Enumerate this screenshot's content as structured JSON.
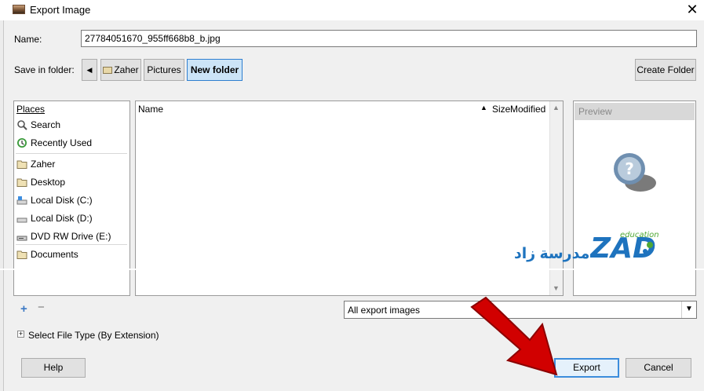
{
  "window": {
    "title": "Export Image"
  },
  "name_row": {
    "label": "Name:",
    "value": "27784051670_955ff668b8_b.jpg"
  },
  "folder_row": {
    "label": "Save in folder:",
    "crumbs": [
      "Zaher",
      "Pictures",
      "New folder"
    ],
    "create_folder": "Create Folder"
  },
  "places": {
    "header": "Places",
    "items": [
      {
        "label": "Search",
        "icon": "search-icon"
      },
      {
        "label": "Recently Used",
        "icon": "clock-icon"
      },
      {
        "label": "Zaher",
        "icon": "folder-icon"
      },
      {
        "label": "Desktop",
        "icon": "folder-icon"
      },
      {
        "label": "Local Disk (C:)",
        "icon": "drive-icon"
      },
      {
        "label": "Local Disk (D:)",
        "icon": "drive-icon"
      },
      {
        "label": "DVD RW Drive (E:)",
        "icon": "dvd-icon"
      },
      {
        "label": "Documents",
        "icon": "folder-icon"
      }
    ],
    "add": "+",
    "remove": "−"
  },
  "file_list": {
    "col_name": "Name",
    "col_size": "Size",
    "col_modified": "Modified"
  },
  "preview": {
    "header": "Preview"
  },
  "filter": {
    "value": "All export images"
  },
  "file_type": {
    "toggle": "+",
    "label": "Select File Type (By Extension)"
  },
  "buttons": {
    "help": "Help",
    "export": "Export",
    "cancel": "Cancel"
  },
  "watermark": {
    "school": "مدرسة زاد",
    "logo_text": "ZAD",
    "logo_sub": "education"
  },
  "colors": {
    "accent": "#3c8ddc",
    "selected_crumb": "#cce4f7",
    "arrow": "#d10000",
    "brand": "#1e73be",
    "brand_green": "#4fa834"
  }
}
